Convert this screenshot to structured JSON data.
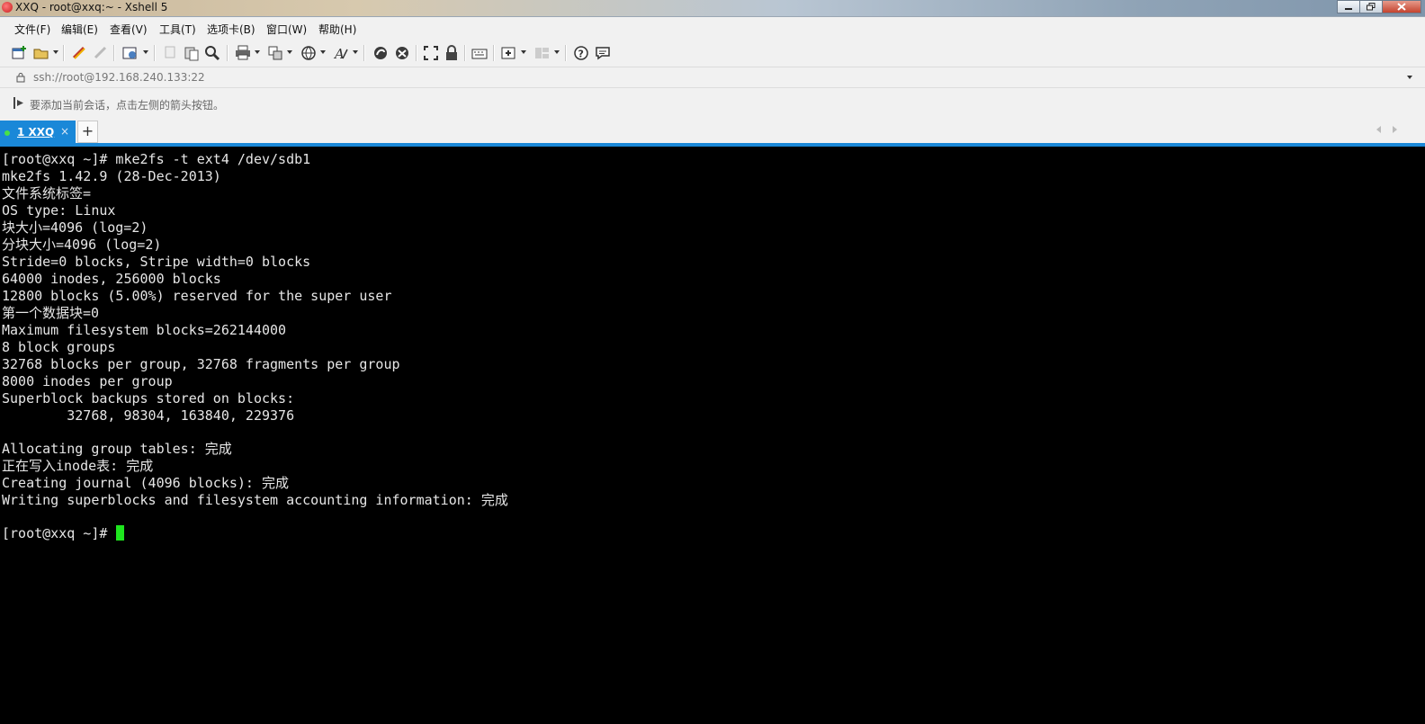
{
  "window": {
    "title": "XXQ - root@xxq:~ - Xshell 5"
  },
  "menu": [
    {
      "label": "文件(F)"
    },
    {
      "label": "编辑(E)"
    },
    {
      "label": "查看(V)"
    },
    {
      "label": "工具(T)"
    },
    {
      "label": "选项卡(B)"
    },
    {
      "label": "窗口(W)"
    },
    {
      "label": "帮助(H)"
    }
  ],
  "toolbar": {
    "icons": [
      "new-session-icon",
      "open-folder-icon",
      "reconnect-icon",
      "disconnect-icon",
      "properties-icon",
      "copy-icon",
      "paste-icon",
      "find-icon",
      "print-icon",
      "transfer-icon",
      "globe-icon",
      "font-icon",
      "xftp-icon",
      "xmanager-icon",
      "fullscreen-icon",
      "lock-icon",
      "keyboard-icon",
      "new-tab-icon",
      "layout-icon",
      "help-icon",
      "chat-icon"
    ]
  },
  "address": {
    "value": "ssh://root@192.168.240.133:22"
  },
  "hint": {
    "text": "要添加当前会话，点击左侧的箭头按钮。"
  },
  "tabs": [
    {
      "label": "1 XXQ",
      "close": "×"
    }
  ],
  "tab_add": "+",
  "terminal": {
    "lines": [
      "[root@xxq ~]# mke2fs -t ext4 /dev/sdb1",
      "mke2fs 1.42.9 (28-Dec-2013)",
      "文件系统标签=",
      "OS type: Linux",
      "块大小=4096 (log=2)",
      "分块大小=4096 (log=2)",
      "Stride=0 blocks, Stripe width=0 blocks",
      "64000 inodes, 256000 blocks",
      "12800 blocks (5.00%) reserved for the super user",
      "第一个数据块=0",
      "Maximum filesystem blocks=262144000",
      "8 block groups",
      "32768 blocks per group, 32768 fragments per group",
      "8000 inodes per group",
      "Superblock backups stored on blocks:",
      "        32768, 98304, 163840, 229376",
      "",
      "Allocating group tables: 完成",
      "正在写入inode表: 完成",
      "Creating journal (4096 blocks): 完成",
      "Writing superblocks and filesystem accounting information: 完成",
      "",
      "[root@xxq ~]# "
    ]
  },
  "colors": {
    "tab_active": "#1a88d8",
    "cursor": "#1ee51e",
    "terminal_bg": "#000000",
    "terminal_fg": "#e6e6e6"
  }
}
